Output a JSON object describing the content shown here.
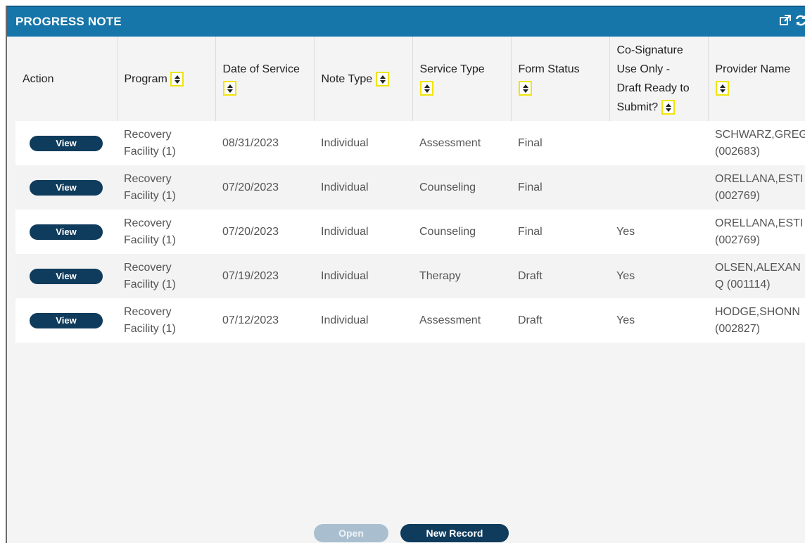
{
  "panel": {
    "title": "PROGRESS NOTE",
    "popout_icon": "external-link-icon",
    "refresh_icon": "refresh-icon"
  },
  "table": {
    "columns": [
      "Action",
      "Program",
      "Date of Service",
      "Note Type",
      "Service Type",
      "Form Status",
      "Co-Signature Use Only - Draft Ready to Submit?",
      "Provider Name"
    ],
    "column_header_lines": {
      "date_of_service": [
        "Date of Service"
      ],
      "cosign": [
        "Co-Signature",
        "Use Only -",
        "Draft Ready to",
        "Submit?"
      ]
    },
    "rows": [
      {
        "action": "View",
        "program_line1": "Recovery",
        "program_line2": "Facility (1)",
        "date": "08/31/2023",
        "note_type": "Individual",
        "service_type": "Assessment",
        "form_status": "Final",
        "cosign": "",
        "provider_line1": "SCHWARZ,GREG",
        "provider_line2": "(002683)"
      },
      {
        "action": "View",
        "program_line1": "Recovery",
        "program_line2": "Facility (1)",
        "date": "07/20/2023",
        "note_type": "Individual",
        "service_type": "Counseling",
        "form_status": "Final",
        "cosign": "",
        "provider_line1": "ORELLANA,ESTI",
        "provider_line2": "(002769)"
      },
      {
        "action": "View",
        "program_line1": "Recovery",
        "program_line2": "Facility (1)",
        "date": "07/20/2023",
        "note_type": "Individual",
        "service_type": "Counseling",
        "form_status": "Final",
        "cosign": "Yes",
        "provider_line1": "ORELLANA,ESTI",
        "provider_line2": "(002769)"
      },
      {
        "action": "View",
        "program_line1": "Recovery",
        "program_line2": "Facility (1)",
        "date": "07/19/2023",
        "note_type": "Individual",
        "service_type": "Therapy",
        "form_status": "Draft",
        "cosign": "Yes",
        "provider_line1": "OLSEN,ALEXAN",
        "provider_line2": "Q (001114)"
      },
      {
        "action": "View",
        "program_line1": "Recovery",
        "program_line2": "Facility (1)",
        "date": "07/12/2023",
        "note_type": "Individual",
        "service_type": "Assessment",
        "form_status": "Draft",
        "cosign": "Yes",
        "provider_line1": "HODGE,SHONN",
        "provider_line2": "(002827)"
      }
    ]
  },
  "footer": {
    "open_label": "Open",
    "new_record_label": "New Record"
  },
  "colors": {
    "header_blue": "#1675a9",
    "button_navy": "#0f3b5c",
    "sort_highlight": "#f0e40a"
  }
}
